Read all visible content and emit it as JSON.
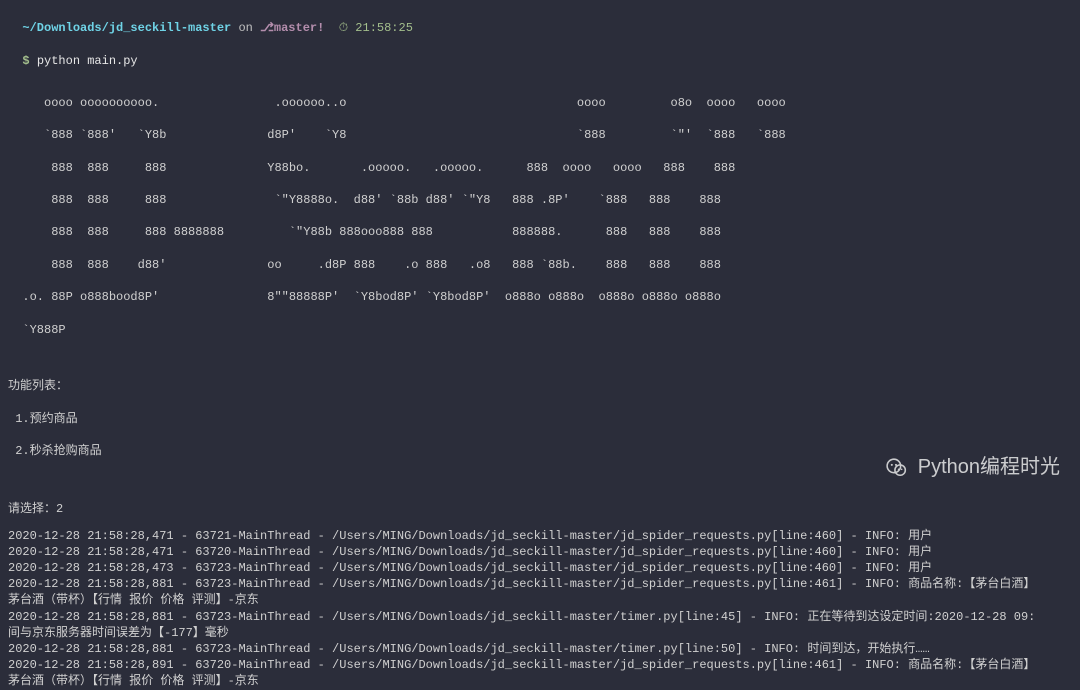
{
  "prompt": {
    "path": "~/Downloads/jd_seckill-master",
    "on": " on ",
    "branch_icon": "⎇",
    "branch": "master!",
    "clock_icon": "⏱",
    "time": "21:58:25",
    "symbol": "$",
    "command": "python main.py"
  },
  "ascii_art": [
    "     oooo oooooooooo.                .oooooo..o                                oooo         o8o  oooo   oooo",
    "     `888 `888'   `Y8b              d8P'    `Y8                                `888         `\"'  `888   `888",
    "      888  888     888              Y88bo.       .ooooo.   .ooooo.      888  oooo   oooo   888    888",
    "      888  888     888               `\"Y8888o.  d88' `88b d88' `\"Y8   888 .8P'    `888   888    888",
    "      888  888     888 8888888         `\"Y88b 888ooo888 888           888888.      888   888    888",
    "      888  888    d88'              oo     .d8P 888    .o 888   .o8   888 `88b.    888   888    888",
    "  .o. 88P o888bood8P'               8\"\"88888P'  `Y8bod8P' `Y8bod8P'  o888o o888o  o888o o888o o888o",
    "  `Y888P"
  ],
  "menu": {
    "title": "功能列表：",
    "items": [
      " 1.预约商品",
      " 2.秒杀抢购商品"
    ],
    "prompt": "请选择：",
    "choice": "2"
  },
  "logs": [
    "2020-12-28 21:58:28,471 - 63721-MainThread - /Users/MING/Downloads/jd_seckill-master/jd_spider_requests.py[line:460] - INFO: 用户",
    "2020-12-28 21:58:28,471 - 63720-MainThread - /Users/MING/Downloads/jd_seckill-master/jd_spider_requests.py[line:460] - INFO: 用户",
    "2020-12-28 21:58:28,473 - 63723-MainThread - /Users/MING/Downloads/jd_seckill-master/jd_spider_requests.py[line:460] - INFO: 用户",
    "2020-12-28 21:58:28,881 - 63723-MainThread - /Users/MING/Downloads/jd_seckill-master/jd_spider_requests.py[line:461] - INFO: 商品名称:【茅台白酒】",
    "茅台酒（带杯）【行情 报价 价格 评测】-京东",
    "2020-12-28 21:58:28,881 - 63723-MainThread - /Users/MING/Downloads/jd_seckill-master/timer.py[line:45] - INFO: 正在等待到达设定时间:2020-12-28 09:",
    "间与京东服务器时间误差为【-177】毫秒",
    "2020-12-28 21:58:28,881 - 63723-MainThread - /Users/MING/Downloads/jd_seckill-master/timer.py[line:50] - INFO: 时间到达，开始执行……",
    "2020-12-28 21:58:28,891 - 63720-MainThread - /Users/MING/Downloads/jd_seckill-master/jd_spider_requests.py[line:461] - INFO: 商品名称:【茅台白酒】",
    "茅台酒（带杯）【行情 报价 价格 评测】-京东"
  ],
  "watermark": {
    "text": "Python编程时光"
  }
}
